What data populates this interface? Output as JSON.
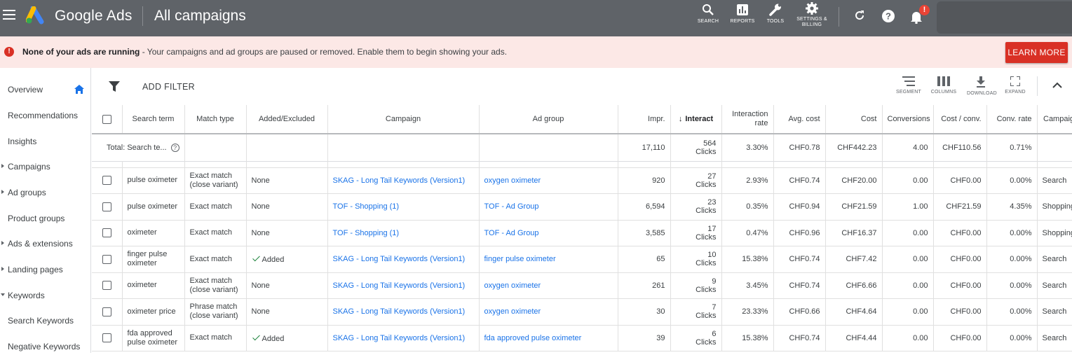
{
  "app": {
    "brand": "Google Ads",
    "page_title": "All campaigns"
  },
  "topbar_tools": [
    {
      "label": "SEARCH",
      "icon": "search-icon"
    },
    {
      "label": "REPORTS",
      "icon": "reports-icon"
    },
    {
      "label": "TOOLS",
      "icon": "wrench-icon"
    },
    {
      "label": "SETTINGS &",
      "label2": "BILLING",
      "icon": "gear-icon"
    }
  ],
  "notification_count": "!",
  "alert": {
    "bold": "None of your ads are running",
    "text": " - Your campaigns and ad groups are paused or removed. Enable them to begin showing your ads.",
    "button": "LEARN MORE"
  },
  "sidebar": {
    "items": [
      {
        "label": "Overview",
        "caret": "none",
        "home": true
      },
      {
        "label": "Recommendations",
        "caret": "none"
      },
      {
        "label": "Insights",
        "caret": "none"
      },
      {
        "label": "Campaigns",
        "caret": "right"
      },
      {
        "label": "Ad groups",
        "caret": "right"
      },
      {
        "label": "Product groups",
        "caret": "none"
      },
      {
        "label": "Ads & extensions",
        "caret": "right"
      },
      {
        "label": "Landing pages",
        "caret": "right"
      },
      {
        "label": "Keywords",
        "caret": "down"
      },
      {
        "label": "Search Keywords",
        "caret": "none"
      },
      {
        "label": "Negative Keywords",
        "caret": "none"
      }
    ]
  },
  "toolbar": {
    "add_filter": "ADD FILTER",
    "tools": [
      "SEGMENT",
      "COLUMNS",
      "DOWNLOAD",
      "EXPAND"
    ]
  },
  "table": {
    "headers": {
      "search_term": "Search term",
      "match_type": "Match type",
      "added_excluded": "Added/Excluded",
      "campaign": "Campaign",
      "ad_group": "Ad group",
      "impr": "Impr.",
      "interactions": "Interact",
      "interaction_rate": "Interaction rate",
      "avg_cost": "Avg. cost",
      "cost": "Cost",
      "conversions": "Conversions",
      "cost_conv": "Cost / conv.",
      "conv_rate": "Conv. rate",
      "campaign_type": "Campaign type"
    },
    "total": {
      "label": "Total: Search te...",
      "help": "?",
      "impr": "17,110",
      "interactions": "564",
      "interactions_unit": "Clicks",
      "interaction_rate": "3.30%",
      "avg_cost": "CHF0.78",
      "cost": "CHF442.23",
      "conversions": "4.00",
      "cost_conv": "CHF110.56",
      "conv_rate": "0.71%"
    },
    "rows": [
      {
        "search_term": "pulse oximeter",
        "match_type": "Exact match (close variant)",
        "added": "None",
        "added_check": false,
        "campaign": "SKAG - Long Tail Keywords (Version1)",
        "ad_group": "oxygen oximeter",
        "impr": "920",
        "interactions": "27",
        "unit": "Clicks",
        "interaction_rate": "2.93%",
        "avg_cost": "CHF0.74",
        "cost": "CHF20.00",
        "conversions": "0.00",
        "cost_conv": "CHF0.00",
        "conv_rate": "0.00%",
        "campaign_type": "Search"
      },
      {
        "search_term": "pulse oximeter",
        "match_type": "Exact match",
        "added": "None",
        "added_check": false,
        "campaign": "TOF - Shopping (1)",
        "ad_group": "TOF - Ad Group",
        "impr": "6,594",
        "interactions": "23",
        "unit": "Clicks",
        "interaction_rate": "0.35%",
        "avg_cost": "CHF0.94",
        "cost": "CHF21.59",
        "conversions": "1.00",
        "cost_conv": "CHF21.59",
        "conv_rate": "4.35%",
        "campaign_type": "Shopping"
      },
      {
        "search_term": "oximeter",
        "match_type": "Exact match",
        "added": "None",
        "added_check": false,
        "campaign": "TOF - Shopping (1)",
        "ad_group": "TOF - Ad Group",
        "impr": "3,585",
        "interactions": "17",
        "unit": "Clicks",
        "interaction_rate": "0.47%",
        "avg_cost": "CHF0.96",
        "cost": "CHF16.37",
        "conversions": "0.00",
        "cost_conv": "CHF0.00",
        "conv_rate": "0.00%",
        "campaign_type": "Shopping"
      },
      {
        "search_term": "finger pulse oximeter",
        "match_type": "Exact match",
        "added": "Added",
        "added_check": true,
        "campaign": "SKAG - Long Tail Keywords (Version1)",
        "ad_group": "finger pulse oximeter",
        "impr": "65",
        "interactions": "10",
        "unit": "Clicks",
        "interaction_rate": "15.38%",
        "avg_cost": "CHF0.74",
        "cost": "CHF7.42",
        "conversions": "0.00",
        "cost_conv": "CHF0.00",
        "conv_rate": "0.00%",
        "campaign_type": "Search"
      },
      {
        "search_term": "oximeter",
        "match_type": "Exact match (close variant)",
        "added": "None",
        "added_check": false,
        "campaign": "SKAG - Long Tail Keywords (Version1)",
        "ad_group": "oxygen oximeter",
        "impr": "261",
        "interactions": "9",
        "unit": "Clicks",
        "interaction_rate": "3.45%",
        "avg_cost": "CHF0.74",
        "cost": "CHF6.66",
        "conversions": "0.00",
        "cost_conv": "CHF0.00",
        "conv_rate": "0.00%",
        "campaign_type": "Search"
      },
      {
        "search_term": "oximeter price",
        "match_type": "Phrase match (close variant)",
        "added": "None",
        "added_check": false,
        "campaign": "SKAG - Long Tail Keywords (Version1)",
        "ad_group": "oxygen oximeter",
        "impr": "30",
        "interactions": "7",
        "unit": "Clicks",
        "interaction_rate": "23.33%",
        "avg_cost": "CHF0.66",
        "cost": "CHF4.64",
        "conversions": "0.00",
        "cost_conv": "CHF0.00",
        "conv_rate": "0.00%",
        "campaign_type": "Search"
      },
      {
        "search_term": "fda approved pulse oximeter",
        "match_type": "Exact match",
        "added": "Added",
        "added_check": true,
        "campaign": "SKAG - Long Tail Keywords (Version1)",
        "ad_group": "fda approved pulse oximeter",
        "impr": "39",
        "interactions": "6",
        "unit": "Clicks",
        "interaction_rate": "15.38%",
        "avg_cost": "CHF0.74",
        "cost": "CHF4.44",
        "conversions": "0.00",
        "cost_conv": "CHF0.00",
        "conv_rate": "0.00%",
        "campaign_type": "Search"
      }
    ]
  }
}
